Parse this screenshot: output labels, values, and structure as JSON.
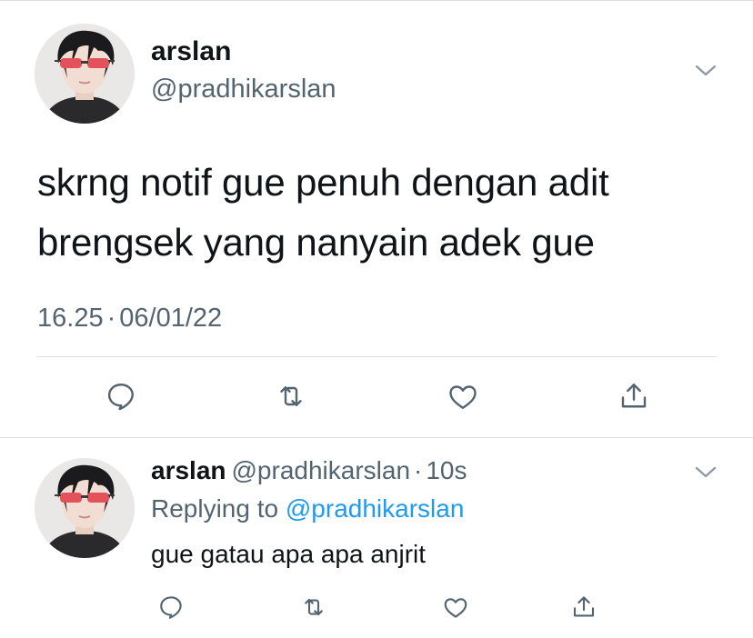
{
  "main_tweet": {
    "author": {
      "name": "arslan",
      "handle": "@pradhikarslan"
    },
    "text": "skrng notif gue penuh dengan adit brengsek yang nanyain adek gue",
    "time": "16.25",
    "separator": "·",
    "date": "06/01/22",
    "actions": [
      "reply-icon",
      "retweet-icon",
      "like-icon",
      "share-icon"
    ]
  },
  "reply_tweet": {
    "author": {
      "name": "arslan",
      "handle": "@pradhikarslan"
    },
    "separator": "·",
    "time_ago": "10s",
    "replying_to_label": "Replying to",
    "replying_to_handle": "@pradhikarslan",
    "text": "gue gatau apa apa anjrit",
    "actions": [
      "reply-icon",
      "retweet-icon",
      "like-icon",
      "share-icon"
    ]
  },
  "colors": {
    "primary_text": "#0f1419",
    "secondary_text": "#536471",
    "link": "#1d9bf0",
    "divider": "#dadfe3",
    "sunglasses_lens": "#e3525b"
  }
}
